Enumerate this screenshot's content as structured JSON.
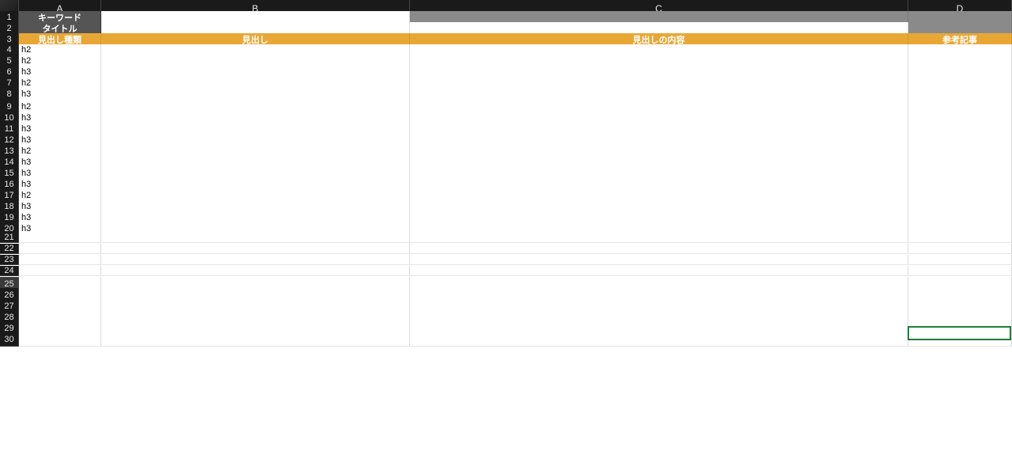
{
  "columns": [
    "A",
    "B",
    "C",
    "D"
  ],
  "row1": {
    "a": "キーワード"
  },
  "row2": {
    "a": "タイトル"
  },
  "row3": {
    "a": "見出し種類",
    "b": "見出し",
    "c": "見出しの内容",
    "d": "参考記事"
  },
  "bodyRows": [
    {
      "n": 4,
      "a": "h2"
    },
    {
      "n": 5,
      "a": "h2"
    },
    {
      "n": 6,
      "a": "h3"
    },
    {
      "n": 7,
      "a": "h2"
    },
    {
      "n": 8,
      "a": "h3"
    },
    {
      "n": 9,
      "a": "h2"
    },
    {
      "n": 10,
      "a": "h3"
    },
    {
      "n": 11,
      "a": "h3"
    },
    {
      "n": 12,
      "a": "h3"
    },
    {
      "n": 13,
      "a": "h2"
    },
    {
      "n": 14,
      "a": "h3"
    },
    {
      "n": 15,
      "a": "h3"
    },
    {
      "n": 16,
      "a": "h3"
    },
    {
      "n": 17,
      "a": "h2"
    },
    {
      "n": 18,
      "a": "h3"
    },
    {
      "n": 19,
      "a": "h3"
    },
    {
      "n": 20,
      "a": "h3"
    }
  ],
  "emptyRows": [
    21,
    22,
    23,
    24,
    25,
    26,
    27,
    28,
    29,
    30
  ],
  "activeCell": {
    "row": 25,
    "col": "D"
  }
}
